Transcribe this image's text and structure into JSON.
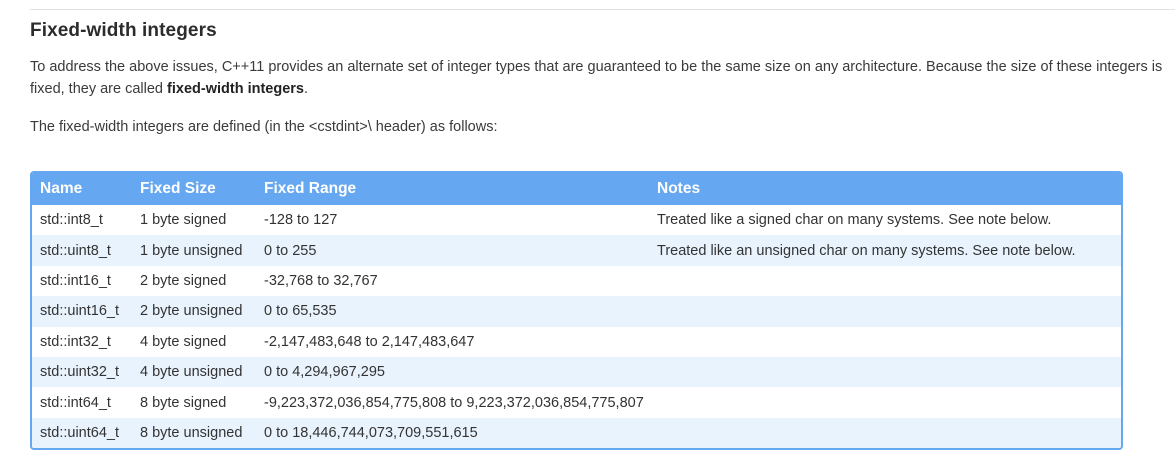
{
  "section": {
    "title": "Fixed-width integers",
    "para1_text": "To address the above issues, C++11 provides an alternate set of integer types that are guaranteed to be the same size on any architecture. Because the size of these integers is fixed, they are called ",
    "para1_bold": "fixed-width integers",
    "para1_end": ".",
    "para2": "The fixed-width integers are defined (in the <cstdint>\\ header) as follows:"
  },
  "table": {
    "headers": [
      "Name",
      "Fixed Size",
      "Fixed Range",
      "Notes"
    ],
    "rows": [
      [
        "std::int8_t",
        "1 byte signed",
        "-128 to 127",
        "Treated like a signed char on many systems. See note below."
      ],
      [
        "std::uint8_t",
        "1 byte unsigned",
        "0 to 255",
        "Treated like an unsigned char on many systems. See note below."
      ],
      [
        "std::int16_t",
        "2 byte signed",
        "-32,768 to 32,767",
        ""
      ],
      [
        "std::uint16_t",
        "2 byte unsigned",
        "0 to 65,535",
        ""
      ],
      [
        "std::int32_t",
        "4 byte signed",
        "-2,147,483,648 to 2,147,483,647",
        ""
      ],
      [
        "std::uint32_t",
        "4 byte unsigned",
        "0 to 4,294,967,295",
        ""
      ],
      [
        "std::int64_t",
        "8 byte signed",
        "-9,223,372,036,854,775,808 to 9,223,372,036,854,775,807",
        ""
      ],
      [
        "std::uint64_t",
        "8 byte unsigned",
        "0 to 18,446,744,073,709,551,615",
        ""
      ]
    ]
  },
  "colors": {
    "header_bg": "#65a7f0",
    "row_alt_bg": "#e9f3fd"
  }
}
